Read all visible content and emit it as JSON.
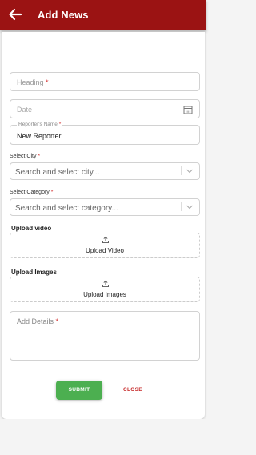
{
  "header": {
    "title": "Add News",
    "bg_color": "#9b1313",
    "back_icon": "arrow-left-icon"
  },
  "form": {
    "heading": {
      "placeholder": "Heading",
      "required_mark": "*"
    },
    "date": {
      "placeholder": "Date",
      "icon": "calendar-icon"
    },
    "reporter": {
      "label": "Reporter's Name",
      "required_mark": "*",
      "value": "New Reporter"
    },
    "city": {
      "label": "Select City",
      "required_mark": "*",
      "placeholder": "Search and select city...",
      "icon": "chevron-down-icon"
    },
    "category": {
      "label": "Select Category",
      "required_mark": "*",
      "placeholder": "Search and select category...",
      "icon": "chevron-down-icon"
    },
    "upload_video": {
      "title": "Upload video",
      "button_label": "Upload Video",
      "icon": "upload-icon"
    },
    "upload_images": {
      "title": "Upload Images",
      "button_label": "Upload Images",
      "icon": "upload-icon"
    },
    "details": {
      "placeholder": "Add Details",
      "required_mark": "*"
    }
  },
  "actions": {
    "submit_label": "SUBMIT",
    "close_label": "CLOSE",
    "submit_color": "#4caf50",
    "close_color": "#c62828"
  }
}
